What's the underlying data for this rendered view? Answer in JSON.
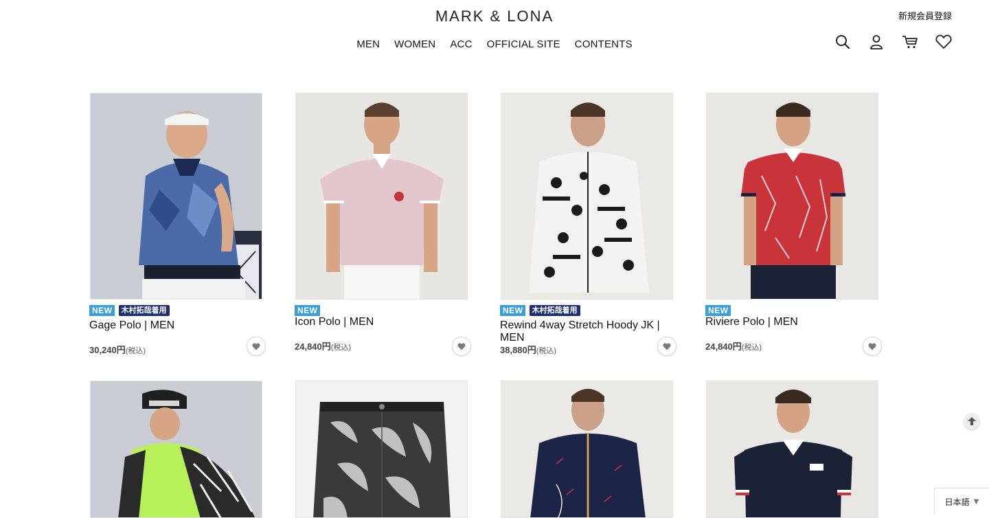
{
  "header": {
    "logo": "MARK & LONA",
    "register_link": "新規会員登録",
    "nav": [
      "MEN",
      "WOMEN",
      "ACC",
      "OFFICIAL SITE",
      "CONTENTS"
    ],
    "icons": [
      "search-icon",
      "account-icon",
      "cart-icon",
      "wishlist-heart-icon"
    ]
  },
  "products": [
    {
      "name": "Gage Polo | MEN",
      "price": "30,240円",
      "tax": "(税込)",
      "badges": [
        "NEW",
        "木村拓哉着用"
      ]
    },
    {
      "name": "Icon Polo | MEN",
      "price": "24,840円",
      "tax": "(税込)",
      "badges": [
        "NEW"
      ]
    },
    {
      "name": "Rewind 4way Stretch Hoody JK | MEN",
      "price": "38,880円",
      "tax": "(税込)",
      "badges": [
        "NEW",
        "木村拓哉着用"
      ]
    },
    {
      "name": "Riviere Polo | MEN",
      "price": "24,840円",
      "tax": "(税込)",
      "badges": [
        "NEW"
      ]
    }
  ],
  "footer": {
    "language": "日本語"
  },
  "colors": {
    "new_badge": "#3a9fd6",
    "wear_badge": "#1d2f6e",
    "text": "#1a1a1a"
  }
}
